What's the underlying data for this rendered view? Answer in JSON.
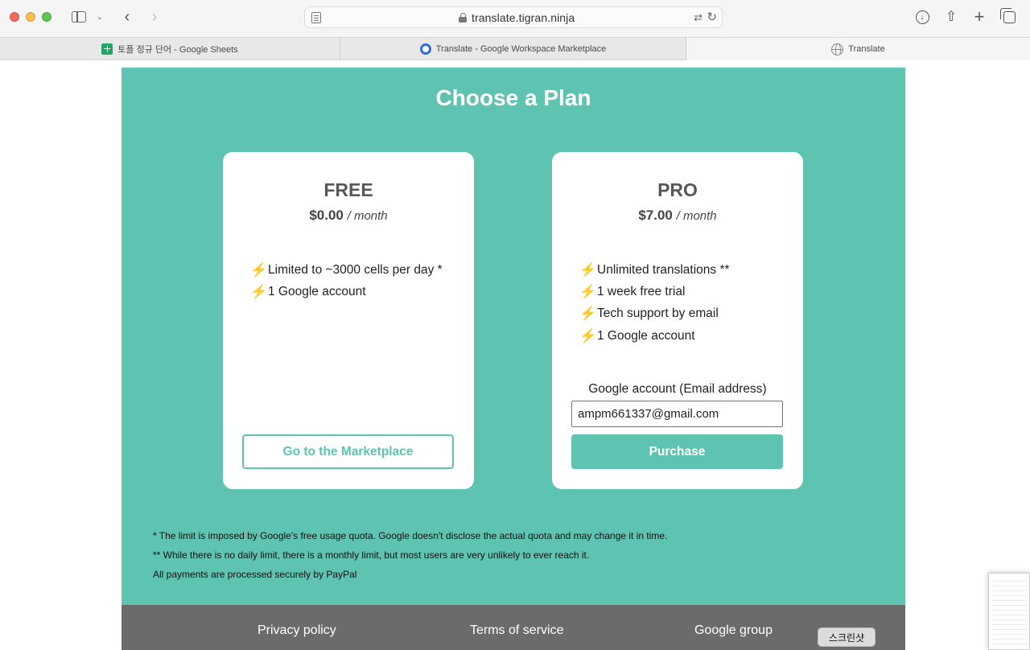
{
  "browser": {
    "url": "translate.tigran.ninja",
    "tabs": [
      {
        "label": "토플 정규 단어 - Google Sheets",
        "icon": "sheets-icon"
      },
      {
        "label": "Translate - Google Workspace Marketplace",
        "icon": "marketplace-icon"
      },
      {
        "label": "Translate",
        "icon": "globe-icon",
        "active": true
      }
    ]
  },
  "page": {
    "title": "Choose a Plan",
    "accent_color": "#5ec3b1",
    "plans": {
      "free": {
        "name": "FREE",
        "price": "$0.00",
        "period": "/ month",
        "features": [
          "Limited to ~3000 cells per day *",
          "1 Google account"
        ],
        "button_label": "Go to the Marketplace"
      },
      "pro": {
        "name": "PRO",
        "price": "$7.00",
        "period": "/ month",
        "features": [
          "Unlimited translations **",
          "1 week free trial",
          "Tech support by email",
          "1 Google account"
        ],
        "email_label": "Google account (Email address)",
        "email_value": "ampm661337@gmail.com",
        "button_label": "Purchase"
      }
    },
    "footnotes": [
      "* The limit is imposed by Google's free usage quota. Google doesn't disclose the actual quota and may change it in time.",
      "** While there is no daily limit, there is a monthly limit, but most users are very unlikely to ever reach it.",
      "All payments are processed securely by PayPal"
    ],
    "footer_links": [
      "Privacy policy",
      "Terms of service",
      "Google group"
    ]
  },
  "overlay": {
    "tooltip": "스크린샷"
  }
}
